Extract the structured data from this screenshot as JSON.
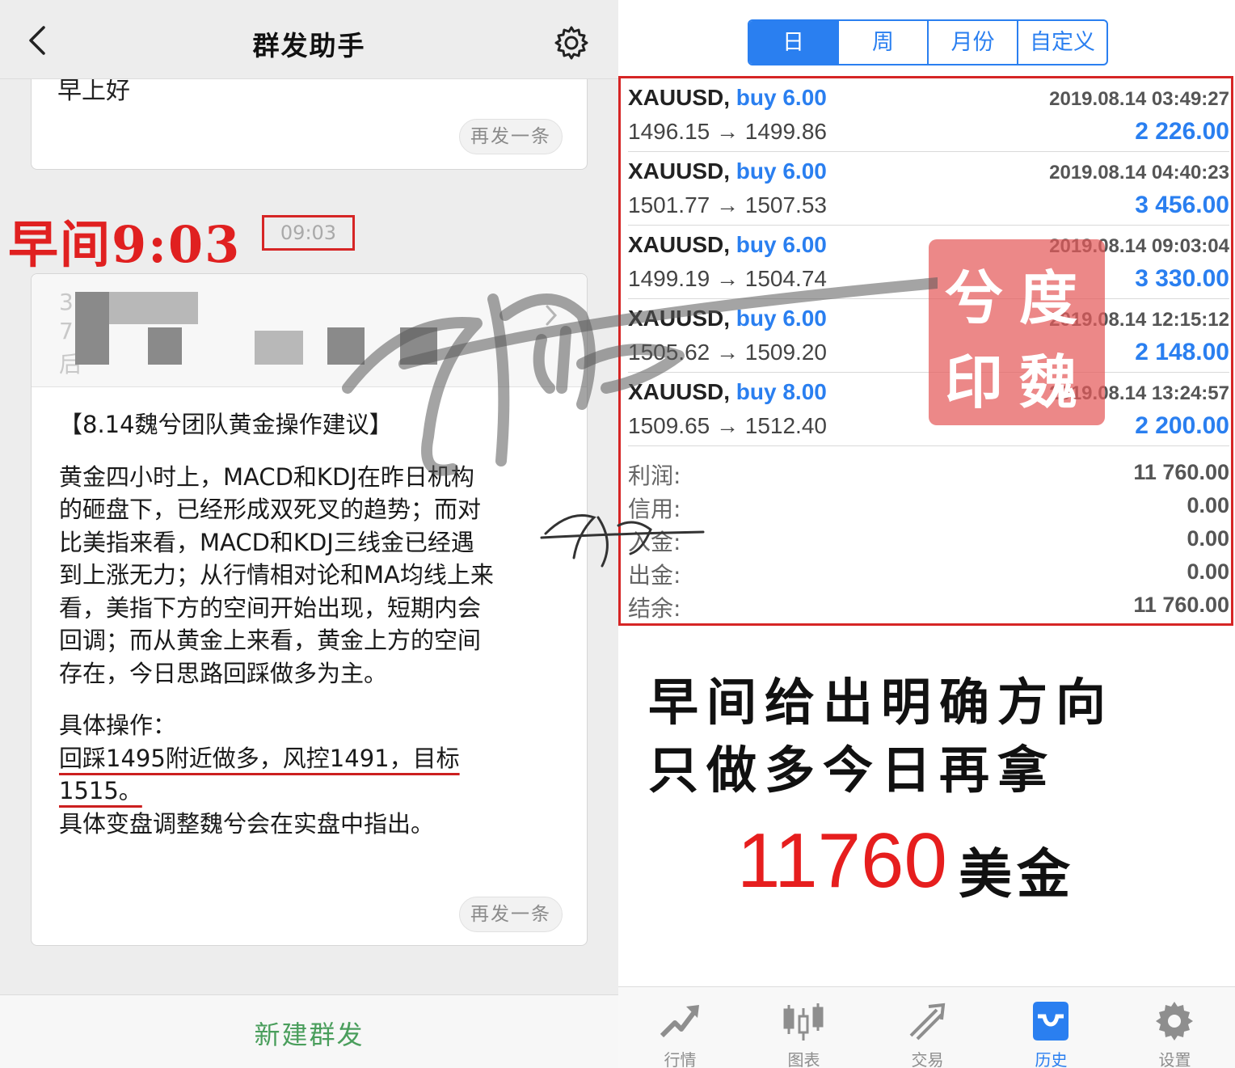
{
  "left": {
    "nav": {
      "title": "群发助手",
      "back_icon": "chevron-left-icon",
      "settings_icon": "gear-icon"
    },
    "card1": {
      "cut_text": "早上好",
      "resend": "再发一条"
    },
    "annotation_time": "早间9:03",
    "timestamp": "09:03",
    "card2": {
      "lines": [
        "【8.14魏兮团队黄金操作建议】",
        "黄金四小时上，MACD和KDJ在昨日机构",
        "的砸盘下，已经形成双死叉的趋势；而对",
        "比美指来看，MACD和KDJ三线金已经遇",
        "到上涨无力；从行情相对论和MA均线上来",
        "看，美指下方的空间开始出现，短期内会",
        "回调；而从黄金上来看，黄金上方的空间",
        "存在，今日思路回踩做多为主。",
        "具体操作：",
        "回踩1495附近做多，风控1491，目标",
        "1515。",
        "具体变盘调整魏兮会在实盘中指出。"
      ],
      "resend": "再发一条"
    },
    "bottom_button": "新建群发"
  },
  "right": {
    "segments": [
      {
        "label": "日",
        "active": true
      },
      {
        "label": "周",
        "active": false
      },
      {
        "label": "月份",
        "active": false
      },
      {
        "label": "自定义",
        "active": false
      }
    ],
    "trades": [
      {
        "symbol": "XAUUSD,",
        "side": "buy 6.00",
        "datetime": "2019.08.14 03:49:27",
        "prices": "1496.15 → 1499.86",
        "profit": "2 226.00"
      },
      {
        "symbol": "XAUUSD,",
        "side": "buy 6.00",
        "datetime": "2019.08.14 04:40:23",
        "prices": "1501.77 → 1507.53",
        "profit": "3 456.00"
      },
      {
        "symbol": "XAUUSD,",
        "side": "buy 6.00",
        "datetime": "2019.08.14 09:03:04",
        "prices": "1499.19 → 1504.74",
        "profit": "3 330.00"
      },
      {
        "symbol": "XAUUSD,",
        "side": "buy 6.00",
        "datetime": "2019.08.14 12:15:12",
        "prices": "1505.62 → 1509.20",
        "profit": "2 148.00"
      },
      {
        "symbol": "XAUUSD,",
        "side": "buy 8.00",
        "datetime": "2019.08.14 13:24:57",
        "prices": "1509.65 → 1512.40",
        "profit": "2 200.00"
      }
    ],
    "summary": [
      {
        "label": "利润:",
        "value": "11 760.00"
      },
      {
        "label": "信用:",
        "value": "0.00"
      },
      {
        "label": "入金:",
        "value": "0.00"
      },
      {
        "label": "出金:",
        "value": "0.00"
      },
      {
        "label": "结余:",
        "value": "11 760.00"
      }
    ],
    "stamp": [
      "兮",
      "度",
      "印",
      "魏"
    ],
    "callout_line1": "早间给出明确方向",
    "callout_line2": "只做多今日再拿",
    "amount": "11760",
    "amount_unit": "美金",
    "tabs": [
      {
        "label": "行情",
        "icon": "quotes-icon",
        "active": false
      },
      {
        "label": "图表",
        "icon": "candlestick-chart-icon",
        "active": false
      },
      {
        "label": "交易",
        "icon": "trade-icon",
        "active": false
      },
      {
        "label": "历史",
        "icon": "history-inbox-icon",
        "active": true
      },
      {
        "label": "设置",
        "icon": "gear-icon",
        "active": false
      }
    ],
    "colors": {
      "accent": "#2a7ff0",
      "annotation_red": "#d62525",
      "wechat_green": "#4a9e5c"
    }
  }
}
